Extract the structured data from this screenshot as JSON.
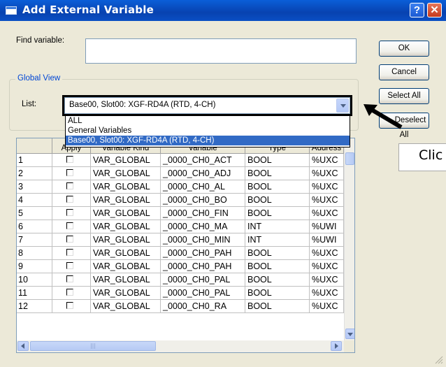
{
  "window": {
    "title": "Add External Variable",
    "help_glyph": "?",
    "close_glyph": "✕"
  },
  "find": {
    "label": "Find variable:",
    "value": ""
  },
  "buttons": {
    "ok": "OK",
    "cancel": "Cancel",
    "select_all": "Select All",
    "deselect_all": "Deselect All"
  },
  "group": {
    "legend": "Global View",
    "list_label": "List:"
  },
  "combo": {
    "selected": "Base00, Slot00:  XGF-RD4A (RTD, 4-CH)"
  },
  "dropdown": {
    "options": [
      "ALL",
      "General Variables",
      "Base00, Slot00:  XGF-RD4A (RTD, 4-CH)"
    ],
    "selected_index": 2
  },
  "callout": {
    "text": "Clic"
  },
  "grid": {
    "headers": [
      "",
      "Apply",
      "Variable Kind",
      "Variable",
      "Type",
      "Address"
    ],
    "rows": [
      {
        "num": "1",
        "kind": "VAR_GLOBAL",
        "var": "_0000_CH0_ACT",
        "type": "BOOL",
        "addr": "%UXC"
      },
      {
        "num": "2",
        "kind": "VAR_GLOBAL",
        "var": "_0000_CH0_ADJ",
        "type": "BOOL",
        "addr": "%UXC"
      },
      {
        "num": "3",
        "kind": "VAR_GLOBAL",
        "var": "_0000_CH0_AL",
        "type": "BOOL",
        "addr": "%UXC"
      },
      {
        "num": "4",
        "kind": "VAR_GLOBAL",
        "var": "_0000_CH0_BO",
        "type": "BOOL",
        "addr": "%UXC"
      },
      {
        "num": "5",
        "kind": "VAR_GLOBAL",
        "var": "_0000_CH0_FIN",
        "type": "BOOL",
        "addr": "%UXC"
      },
      {
        "num": "6",
        "kind": "VAR_GLOBAL",
        "var": "_0000_CH0_MA",
        "type": "INT",
        "addr": "%UWI"
      },
      {
        "num": "7",
        "kind": "VAR_GLOBAL",
        "var": "_0000_CH0_MIN",
        "type": "INT",
        "addr": "%UWI"
      },
      {
        "num": "8",
        "kind": "VAR_GLOBAL",
        "var": "_0000_CH0_PAH",
        "type": "BOOL",
        "addr": "%UXC"
      },
      {
        "num": "9",
        "kind": "VAR_GLOBAL",
        "var": "_0000_CH0_PAH",
        "type": "BOOL",
        "addr": "%UXC"
      },
      {
        "num": "10",
        "kind": "VAR_GLOBAL",
        "var": "_0000_CH0_PAL",
        "type": "BOOL",
        "addr": "%UXC"
      },
      {
        "num": "11",
        "kind": "VAR_GLOBAL",
        "var": "_0000_CH0_PAL",
        "type": "BOOL",
        "addr": "%UXC"
      },
      {
        "num": "12",
        "kind": "VAR_GLOBAL",
        "var": "_0000_CH0_RA",
        "type": "BOOL",
        "addr": "%UXC"
      }
    ]
  },
  "icons": {
    "window": "window-icon",
    "combo_arrow": "chevron-down-icon",
    "pointer": "arrow-pointer-icon"
  },
  "colors": {
    "titlebar": "#0842b0",
    "dialog_bg": "#ece9d8",
    "selection": "#316ac5",
    "group_legend": "#0046d5"
  }
}
